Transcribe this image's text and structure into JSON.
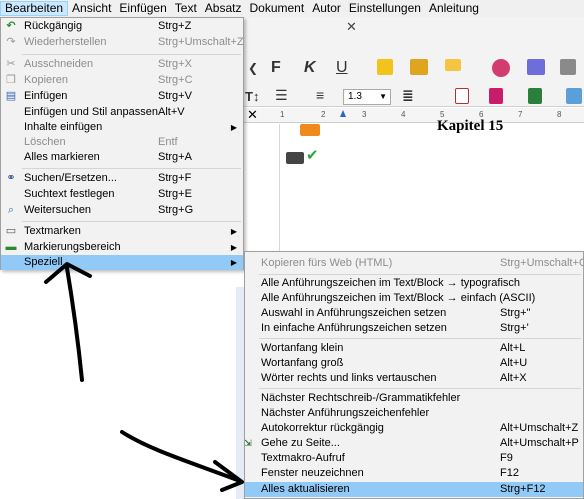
{
  "menubar": {
    "items": [
      "Bearbeiten",
      "Ansicht",
      "Einfügen",
      "Text",
      "Absatz",
      "Dokument",
      "Autor",
      "Einstellungen",
      "Anleitung"
    ],
    "active": "Bearbeiten"
  },
  "toolbar": {
    "bold_glyph": "F",
    "italic_glyph": "K",
    "underline_glyph": "U",
    "line_spacing_value": "1.3",
    "ruler_numbers": [
      "1",
      "2",
      "3",
      "4",
      "5",
      "6",
      "7",
      "8"
    ]
  },
  "document": {
    "heading": "Kapitel 15"
  },
  "edit_menu": {
    "items": [
      {
        "label": "Rückgängig",
        "shortcut": "Strg+Z",
        "icon": "undo-icon",
        "enabled": true
      },
      {
        "label": "Wiederherstellen",
        "shortcut": "Strg+Umschalt+Z",
        "icon": "redo-icon",
        "enabled": false
      },
      {
        "label": "Ausschneiden",
        "shortcut": "Strg+X",
        "icon": "cut-icon",
        "enabled": false
      },
      {
        "label": "Kopieren",
        "shortcut": "Strg+C",
        "icon": "copy-icon",
        "enabled": false
      },
      {
        "label": "Einfügen",
        "shortcut": "Strg+V",
        "icon": "paste-icon",
        "enabled": true
      },
      {
        "label": "Einfügen und Stil anpassen",
        "shortcut": "Alt+V",
        "icon": "",
        "enabled": true
      },
      {
        "label": "Inhalte einfügen",
        "shortcut": "",
        "icon": "",
        "enabled": true
      },
      {
        "label": "Löschen",
        "shortcut": "Entf",
        "icon": "",
        "enabled": false
      },
      {
        "label": "Alles markieren",
        "shortcut": "Strg+A",
        "icon": "",
        "enabled": true
      },
      {
        "label": "Suchen/Ersetzen...",
        "shortcut": "Strg+F",
        "icon": "binoculars-icon",
        "enabled": true
      },
      {
        "label": "Suchtext festlegen",
        "shortcut": "Strg+E",
        "icon": "",
        "enabled": true
      },
      {
        "label": "Weitersuchen",
        "shortcut": "Strg+G",
        "icon": "search-next-icon",
        "enabled": true
      },
      {
        "label": "Textmarken",
        "shortcut": "",
        "icon": "bookmark-icon",
        "enabled": true
      },
      {
        "label": "Markierungsbereich",
        "shortcut": "",
        "icon": "selection-range-icon",
        "enabled": true
      },
      {
        "label": "Speziell",
        "shortcut": "",
        "icon": "",
        "enabled": true
      }
    ]
  },
  "special_menu": {
    "items": [
      {
        "label": "Kopieren fürs Web (HTML)",
        "shortcut": "Strg+Umschalt+C",
        "enabled": false
      },
      {
        "label": "Alle Anführungszeichen im Text/Block → typografisch",
        "shortcut": "",
        "enabled": true
      },
      {
        "label": "Alle Anführungszeichen im Text/Block → einfach (ASCII)",
        "shortcut": "",
        "enabled": true
      },
      {
        "label": "Auswahl in Anführungszeichen setzen",
        "shortcut": "Strg+\"",
        "enabled": true
      },
      {
        "label": "In einfache Anführungszeichen setzen",
        "shortcut": "Strg+'",
        "enabled": true
      },
      {
        "label": "Wortanfang klein",
        "shortcut": "Alt+L",
        "enabled": true
      },
      {
        "label": "Wortanfang groß",
        "shortcut": "Alt+U",
        "enabled": true
      },
      {
        "label": "Wörter rechts und links vertauschen",
        "shortcut": "Alt+X",
        "enabled": true
      },
      {
        "label": "Nächster Rechtschreib-/Grammatikfehler",
        "shortcut": "",
        "enabled": true
      },
      {
        "label": "Nächster Anführungszeichenfehler",
        "shortcut": "",
        "enabled": true
      },
      {
        "label": "Autokorrektur rückgängig",
        "shortcut": "Alt+Umschalt+Z",
        "enabled": true
      },
      {
        "label": "Gehe zu Seite...",
        "shortcut": "Alt+Umschalt+P",
        "enabled": true
      },
      {
        "label": "Textmakro-Aufruf",
        "shortcut": "F9",
        "enabled": true
      },
      {
        "label": "Fenster neuzeichnen",
        "shortcut": "F12",
        "enabled": true
      },
      {
        "label": "Alles aktualisieren",
        "shortcut": "Strg+F12",
        "enabled": true
      }
    ]
  },
  "colors": {
    "highlight": "#91c9f7",
    "menu_bg": "#f2f2f2",
    "arrow": "#000000"
  }
}
